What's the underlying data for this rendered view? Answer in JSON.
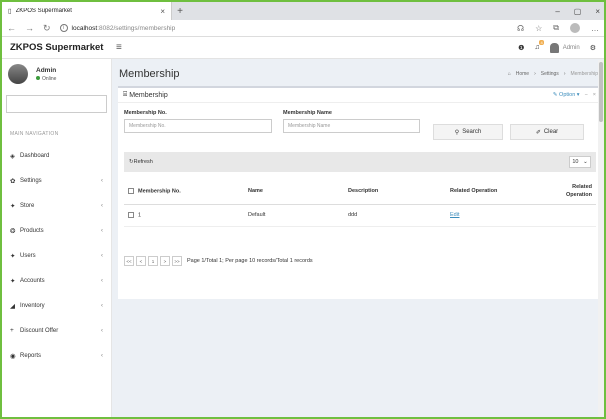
{
  "browser": {
    "tab_title": "ZKPOS Supermarket",
    "tab_close": "×",
    "new_tab": "+",
    "url_host": "localhost",
    "url_rest": ":8082/settings/membership",
    "win_min": "–",
    "win_max": "▢",
    "win_close": "×"
  },
  "app": {
    "brand": "ZKPOS Supermarket",
    "notif_count": "4",
    "user_label": "Admin"
  },
  "sidebar": {
    "user_name": "Admin",
    "user_status": "Online",
    "nav_header": "MAIN NAVIGATION",
    "items": [
      {
        "label": "Dashboard",
        "icon": "dashboard-icon",
        "glyph": "◈",
        "has_children": false
      },
      {
        "label": "Settings",
        "icon": "gear-icon",
        "glyph": "✿",
        "has_children": true
      },
      {
        "label": "Store",
        "icon": "store-icon",
        "glyph": "✦",
        "has_children": true
      },
      {
        "label": "Products",
        "icon": "products-icon",
        "glyph": "❂",
        "has_children": true
      },
      {
        "label": "Users",
        "icon": "users-icon",
        "glyph": "✦",
        "has_children": true
      },
      {
        "label": "Accounts",
        "icon": "accounts-icon",
        "glyph": "✦",
        "has_children": true
      },
      {
        "label": "Inventory",
        "icon": "inventory-icon",
        "glyph": "◢",
        "has_children": true
      },
      {
        "label": "Discount Offer",
        "icon": "plus-icon",
        "glyph": "+",
        "has_children": true
      },
      {
        "label": "Reports",
        "icon": "reports-icon",
        "glyph": "◉",
        "has_children": true
      }
    ],
    "chevron": "‹"
  },
  "page": {
    "title": "Membership",
    "breadcrumb_home": "Home",
    "breadcrumb_settings": "Settings",
    "breadcrumb_current": "Membership"
  },
  "box": {
    "title": "Membership",
    "option_label": "Option",
    "collapse": "−",
    "close": "×"
  },
  "form": {
    "no_label": "Membership No.",
    "no_placeholder": "Membership No.",
    "name_label": "Membership Name",
    "name_placeholder": "Membership Name",
    "search_label": "Search",
    "clear_label": "Clear"
  },
  "toolbar": {
    "refresh_label": "Refresh",
    "page_size": "10"
  },
  "table": {
    "headers": [
      "Membership No.",
      "Name",
      "Description",
      "Related Operation",
      "Related Operation"
    ],
    "rows": [
      {
        "no": "1",
        "name": "Default",
        "description": "ddd",
        "operation": "Edit"
      }
    ]
  },
  "pager": {
    "first": "<<",
    "prev": "<",
    "page": "1",
    "next": ">",
    "last": ">>",
    "info": "Page 1/Total 1; Per page 10 records/Total 1 records"
  }
}
